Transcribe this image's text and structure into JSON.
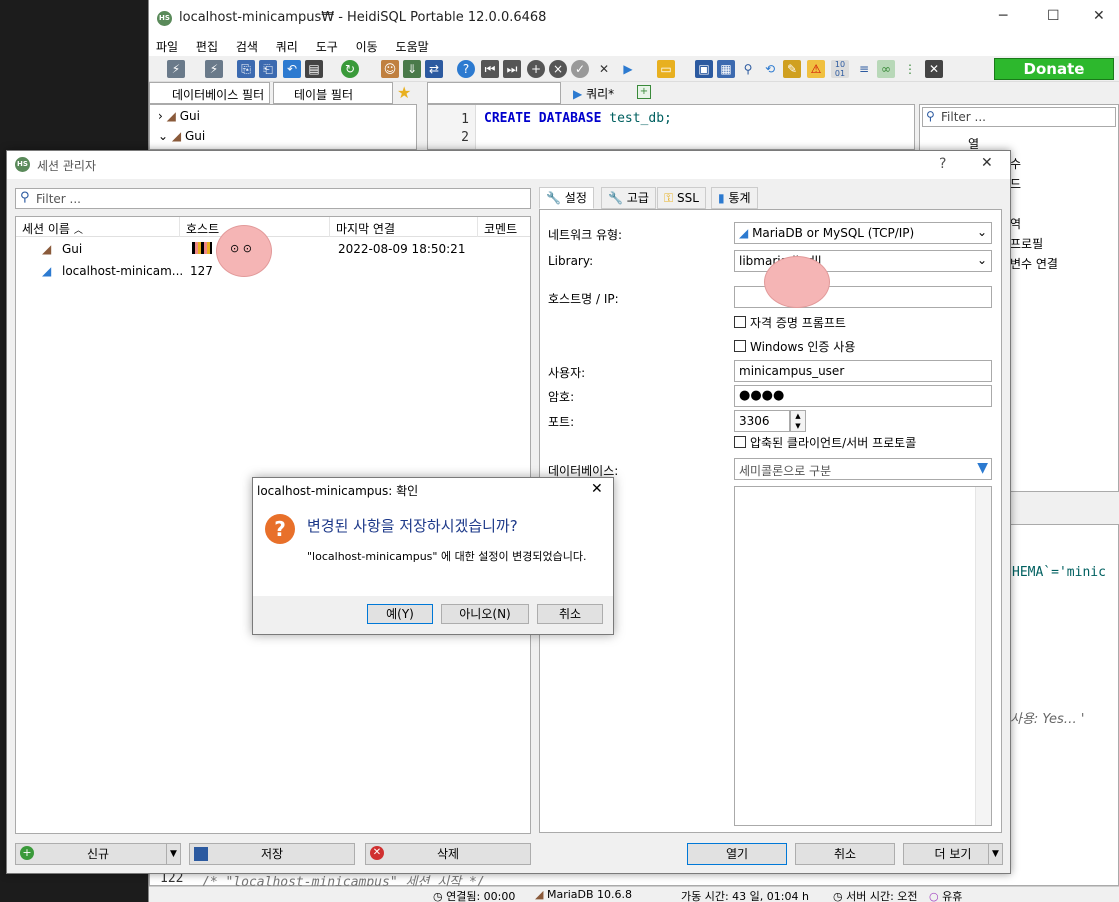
{
  "main": {
    "title": "localhost-minicampus₩ - HeidiSQL Portable 12.0.0.6468",
    "menu": [
      "파일",
      "편집",
      "검색",
      "쿼리",
      "도구",
      "이동",
      "도움말"
    ],
    "donate": "Donate",
    "db_filter": "데이터베이스 필터",
    "table_filter": "테이블 필터",
    "query_tab": "쿼리*",
    "tree": [
      "Gui",
      "Gui"
    ],
    "editor_lines": [
      "1",
      "2"
    ],
    "editor_sql": {
      "kw1": "CREATE",
      "kw2": "DATABASE",
      "name": "test_db;"
    },
    "right_filter": "Filter ...",
    "right_items": [
      "열",
      "수",
      "드",
      "역",
      "프로필",
      "변수 연결"
    ],
    "log_fragment_1": "HEMA`='minic",
    "log_fragment_2": "사용: Yes… '",
    "log_line_no": "122",
    "log_line_text": "/* \"localhost-minicampus\" 세션 시작 */",
    "status": [
      "연결됨: 00:00",
      "MariaDB 10.6.8",
      "가동 시간: 43 일, 01:04 h",
      "서버 시간: 오전",
      "유휴"
    ],
    "window_controls": {
      "min": "─",
      "max": "☐",
      "close": "✕"
    }
  },
  "session_manager": {
    "title": "세션 관리자",
    "help": "?",
    "close": "✕",
    "filter_placeholder": "Filter ...",
    "columns": [
      "세션 이름",
      "호스트",
      "마지막 연결",
      "코멘트"
    ],
    "sessions": [
      {
        "name": "Gui",
        "host": "",
        "last": "2022-08-09 18:50:21"
      },
      {
        "name": "localhost-minicam...",
        "host": "127",
        "last": ""
      }
    ],
    "tabs": [
      "설정",
      "고급",
      "SSL",
      "통계"
    ],
    "fields": {
      "network_label": "네트워크 유형:",
      "network_value": "MariaDB or MySQL (TCP/IP)",
      "library_label": "Library:",
      "library_value": "libmariadb.dll",
      "host_label": "호스트명 / IP:",
      "host_value": "",
      "prompt_label": "자격 증명 프롬프트",
      "windows_auth_label": "Windows 인증 사용",
      "user_label": "사용자:",
      "user_value": "minicampus_user",
      "password_label": "암호:",
      "password_value": "●●●●",
      "port_label": "포트:",
      "port_value": "3306",
      "compressed_label": "압축된 클라이언트/서버 프로토콜",
      "database_label": "데이터베이스:",
      "database_placeholder": "세미콜론으로 구분"
    },
    "buttons": {
      "new": "신규",
      "save": "저장",
      "delete": "삭제",
      "open": "열기",
      "cancel": "취소",
      "more": "더 보기"
    }
  },
  "confirm": {
    "title": "localhost-minicampus: 확인",
    "close": "✕",
    "heading": "변경된 사항을 저장하시겠습니까?",
    "message": "\"localhost-minicampus\" 에 대한 설정이 변경되었습니다.",
    "yes": "예(Y)",
    "no": "아니오(N)",
    "cancel": "취소"
  },
  "colors": {
    "accent": "#0064c8",
    "donate": "#2db82d",
    "keyword": "#0000cc",
    "heading": "#1e3a8a"
  }
}
